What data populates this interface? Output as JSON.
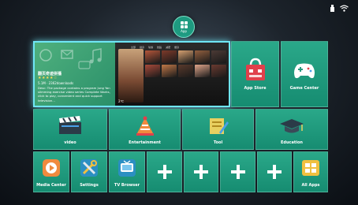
{
  "app_button": {
    "label": "App"
  },
  "featured": {
    "title": "翻页奇迹拼播",
    "stars": "★★★★☆",
    "meta": "5.1M · 2362downloads",
    "description": "Desc: The package contains a program Jung Yan slimming exercise video series Complete Works, click to play, convenient and quick support television...",
    "video_tabs": [
      "全部",
      "健身",
      "瑜伽",
      "舞蹈",
      "减肥",
      "塑身"
    ],
    "caption": "2℃",
    "thumb_colors": [
      "#b5563a",
      "#7d3a2a",
      "#d6a070",
      "#93603f",
      "#4c3a35",
      "#a84a3a",
      "#c07848",
      "#5a3a2c",
      "#e0a58a",
      "#6a3a30"
    ]
  },
  "tiles": {
    "app_store": "App Store",
    "game_center": "Game Center",
    "video": "video",
    "entertainment": "Entertainment",
    "tool": "Tool",
    "education": "Education",
    "media_center": "Media Center",
    "settings": "Settings",
    "tv_browser": "TV Browser",
    "all_apps": "All Apps"
  },
  "colors": {
    "tile": "#1f9b7d",
    "focus": "#6fe6f5",
    "accent_red": "#e0404b",
    "accent_orange": "#f08a3e"
  }
}
